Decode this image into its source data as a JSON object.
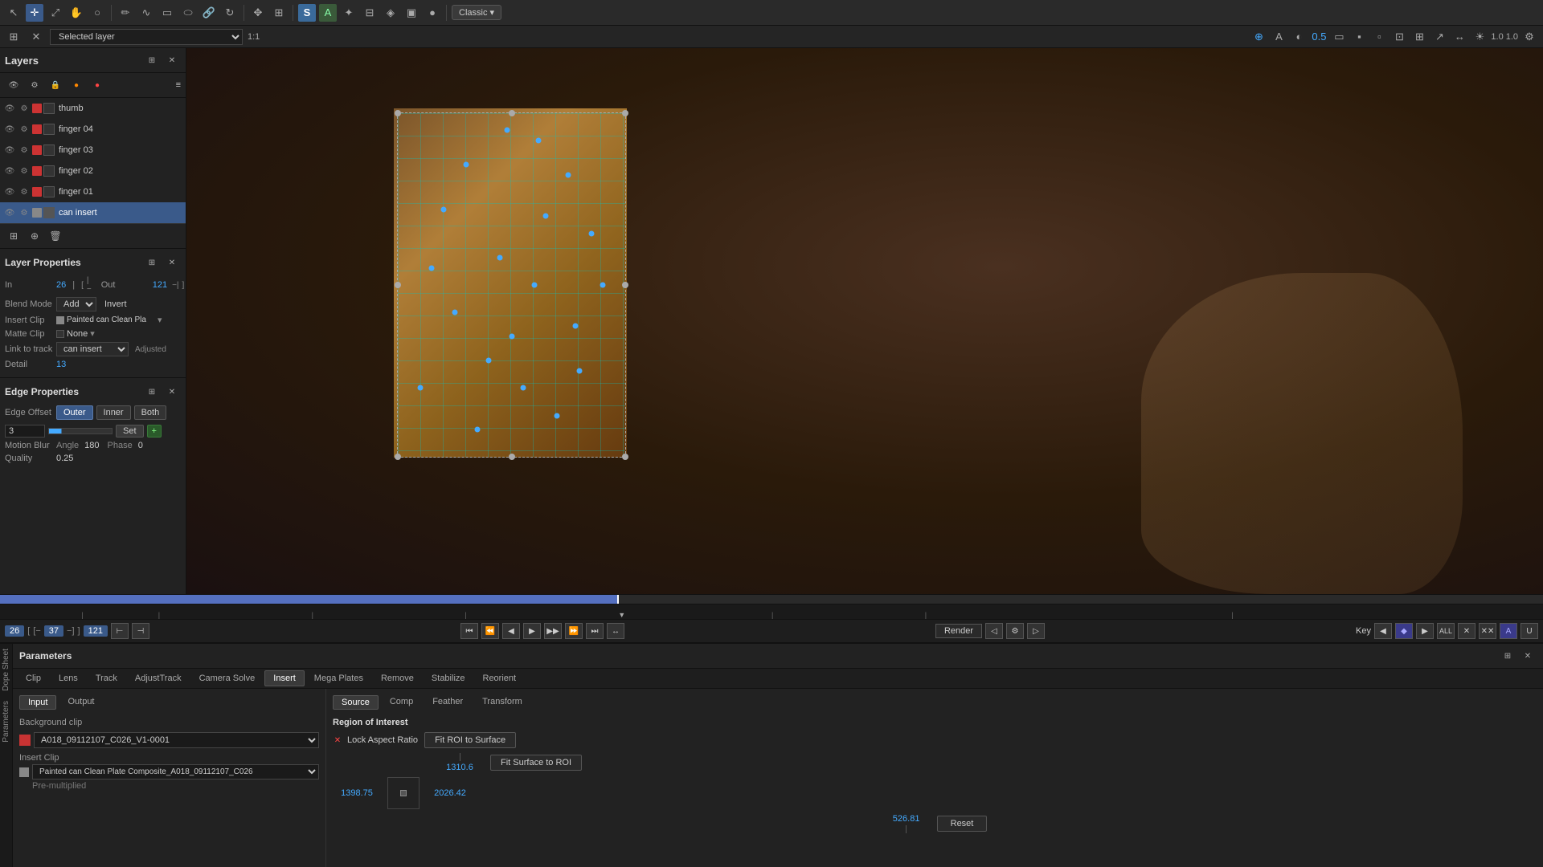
{
  "app": {
    "title": "Layers"
  },
  "toolbar": {
    "classic_label": "Classic ▾",
    "selected_layer_label": "Selected layer"
  },
  "layers": {
    "title": "Layers",
    "items": [
      {
        "name": "thumb",
        "selected": false
      },
      {
        "name": "finger 04",
        "selected": false
      },
      {
        "name": "finger 03",
        "selected": false
      },
      {
        "name": "finger 02",
        "selected": false
      },
      {
        "name": "finger 01",
        "selected": false
      },
      {
        "name": "can insert",
        "selected": true
      }
    ]
  },
  "layer_properties": {
    "title": "Layer Properties",
    "in_label": "In",
    "out_label": "Out",
    "in_value": "26",
    "out_value": "121",
    "blend_mode_label": "Blend Mode",
    "blend_mode_value": "Add",
    "invert_label": "Invert",
    "insert_clip_label": "Insert Clip",
    "insert_clip_value": "Painted can Clean Pla",
    "matte_clip_label": "Matte Clip",
    "matte_clip_value": "None",
    "link_to_track_label": "Link to track",
    "link_to_track_value": "can insert",
    "adjusted_label": "Adjusted",
    "detail_label": "Detail",
    "detail_value": "13"
  },
  "edge_properties": {
    "title": "Edge Properties",
    "edge_offset_label": "Edge Offset",
    "outer_label": "Outer",
    "inner_label": "Inner",
    "both_label": "Both",
    "offset_value": "3",
    "set_label": "Set",
    "motion_blur_label": "Motion Blur",
    "angle_label": "Angle",
    "angle_value": "180",
    "phase_label": "Phase",
    "phase_value": "0",
    "quality_label": "Quality",
    "quality_value": "0.25"
  },
  "params": {
    "title": "Parameters",
    "tabs": [
      "Clip",
      "Lens",
      "Track",
      "AdjustTrack",
      "Camera Solve",
      "Insert",
      "Mega Plates",
      "Remove",
      "Stabilize",
      "Reorient"
    ],
    "active_tab": "Insert",
    "sub_tabs": [
      "Input",
      "Output"
    ],
    "active_sub_tab": "Input",
    "bg_clip_label": "Background clip",
    "bg_clip_value": "A018_09112107_C026_V1-0001",
    "insert_clip_label": "Insert Clip",
    "insert_clip_value": "Painted can Clean Plate Composite_A018_09112107_C026",
    "pre_multiplied_label": "Pre-multiplied",
    "source_tabs": [
      "Source",
      "Comp",
      "Feather",
      "Transform"
    ],
    "active_source_tab": "Source",
    "roi_title": "Region of Interest",
    "lock_aspect_label": "Lock Aspect Ratio",
    "fit_roi_to_surface_label": "Fit ROI to Surface",
    "fit_surface_to_roi_label": "Fit Surface to ROI",
    "roi_width": "1310.6",
    "roi_x": "1398.75",
    "roi_y": "2026.42",
    "roi_height": "526.81",
    "reset_label": "Reset"
  },
  "timeline": {
    "in_frame": "26",
    "current_frame": "37",
    "out_frame": "121",
    "render_label": "Render",
    "key_label": "Key"
  },
  "icons": {
    "arrow": "▶",
    "arrow_left": "◀",
    "gear": "⚙",
    "close": "✕",
    "add": "+",
    "remove": "−",
    "eye": "👁",
    "lock": "🔒",
    "minus": "−",
    "play": "▶",
    "pause": "⏸",
    "skip_back": "⏮",
    "skip_fwd": "⏭",
    "step_back": "◀",
    "step_fwd": "▶",
    "loop": "↺"
  }
}
